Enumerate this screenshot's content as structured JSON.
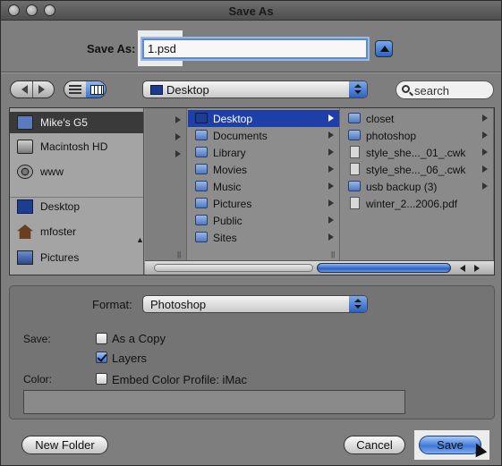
{
  "window": {
    "title": "Save As"
  },
  "save_row": {
    "label": "Save As:",
    "filename": "1.psd"
  },
  "toolbar": {
    "location": "Desktop",
    "search_placeholder": "search"
  },
  "sidebar": {
    "items": [
      {
        "label": "Mike's G5",
        "icon": "computer-icon"
      },
      {
        "label": "Macintosh HD",
        "icon": "hard-drive-icon"
      },
      {
        "label": "www",
        "icon": "network-volume-icon"
      },
      {
        "label": "Desktop",
        "icon": "desktop-icon"
      },
      {
        "label": "mfoster",
        "icon": "home-icon"
      },
      {
        "label": "Pictures",
        "icon": "pictures-icon"
      }
    ]
  },
  "column2": [
    "Desktop",
    "Documents",
    "Library",
    "Movies",
    "Music",
    "Pictures",
    "Public",
    "Sites"
  ],
  "column3": [
    {
      "label": "closet",
      "kind": "folder"
    },
    {
      "label": "photoshop",
      "kind": "folder"
    },
    {
      "label": "style_she..._01_.cwk",
      "kind": "file"
    },
    {
      "label": "style_she..._06_.cwk",
      "kind": "file"
    },
    {
      "label": "usb backup (3)",
      "kind": "folder"
    },
    {
      "label": "winter_2...2006.pdf",
      "kind": "file"
    }
  ],
  "options": {
    "format_label": "Format:",
    "format_value": "Photoshop",
    "save_label": "Save:",
    "as_copy": "As a Copy",
    "layers": "Layers",
    "color_label": "Color:",
    "embed_profile": "Embed Color Profile:  iMac"
  },
  "buttons": {
    "new_folder": "New Folder",
    "cancel": "Cancel",
    "save": "Save"
  }
}
